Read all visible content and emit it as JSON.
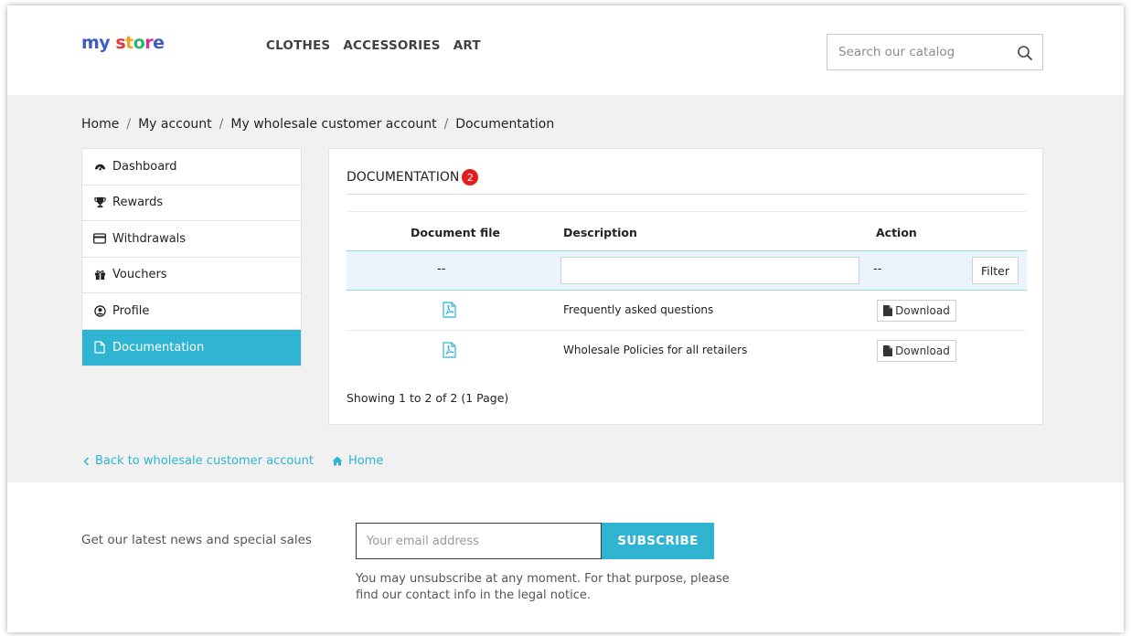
{
  "header": {
    "logo": {
      "part1": "my",
      "s": "s",
      "t": "t",
      "o": "o",
      "r": "r",
      "e": "e"
    },
    "nav": [
      "CLOTHES",
      "ACCESSORIES",
      "ART"
    ],
    "search_placeholder": "Search our catalog",
    "search_icon": "magnifier-icon"
  },
  "breadcrumb": [
    "Home",
    "My account",
    "My wholesale customer account",
    "Documentation"
  ],
  "breadcrumb_separator": "/",
  "sidebar": {
    "items": [
      {
        "label": "Dashboard",
        "icon": "dashboard-icon"
      },
      {
        "label": "Rewards",
        "icon": "trophy-icon"
      },
      {
        "label": "Withdrawals",
        "icon": "credit-card-icon"
      },
      {
        "label": "Vouchers",
        "icon": "gift-icon"
      },
      {
        "label": "Profile",
        "icon": "user-circle-icon"
      },
      {
        "label": "Documentation",
        "icon": "file-icon",
        "active": true
      }
    ]
  },
  "panel": {
    "title": "DOCUMENTATION",
    "count": "2",
    "columns": {
      "file": "Document file",
      "description": "Description",
      "action": "Action"
    },
    "filter": {
      "file_placeholder": "--",
      "action_placeholder": "--",
      "button": "Filter",
      "description_value": ""
    },
    "rows": [
      {
        "description": "Frequently asked questions",
        "action": "Download",
        "file_icon": "pdf-icon"
      },
      {
        "description": "Wholesale Policies for all retailers",
        "action": "Download",
        "file_icon": "pdf-icon"
      }
    ],
    "pagination": "Showing 1 to 2 of 2 (1 Page)"
  },
  "links": {
    "back": "Back to wholesale customer account",
    "home": "Home"
  },
  "footer": {
    "newsletter_label": "Get our latest news and special sales",
    "email_placeholder": "Your email address",
    "subscribe": "SUBSCRIBE",
    "unsubscribe_note": "You may unsubscribe at any moment. For that purpose, please find our contact info in the legal notice."
  },
  "colors": {
    "accent": "#2fb5d2",
    "badge": "#e11d1d"
  }
}
